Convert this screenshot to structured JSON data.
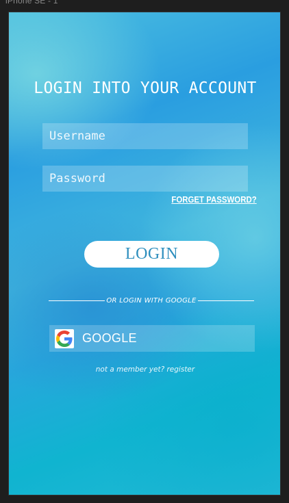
{
  "frame": {
    "label": "iPhone SE - 1"
  },
  "login_screen": {
    "title": "LOGIN INTO YOUR ACCOUNT",
    "username": {
      "placeholder": "Username",
      "value": ""
    },
    "password": {
      "placeholder": "Password",
      "value": ""
    },
    "forget_password_label": "FORGET PASSWORD?",
    "login_button_label": "LOGIN",
    "divider_text": "OR LOGIN WITH GOOGLE",
    "google_button": {
      "label": "GOOGLE",
      "icon": "google-g-icon"
    },
    "register_link": "not a member yet? register"
  },
  "colors": {
    "background_light": "#4cbfe0",
    "background_mid": "#2a9ee0",
    "background_cyan": "#10b4d0",
    "login_button_bg": "#ffffff",
    "login_button_text": "#2f8fbe",
    "text": "#ffffff",
    "google_blue": "#4285F4",
    "google_red": "#EA4335",
    "google_yellow": "#FBBC05",
    "google_green": "#34A853"
  }
}
